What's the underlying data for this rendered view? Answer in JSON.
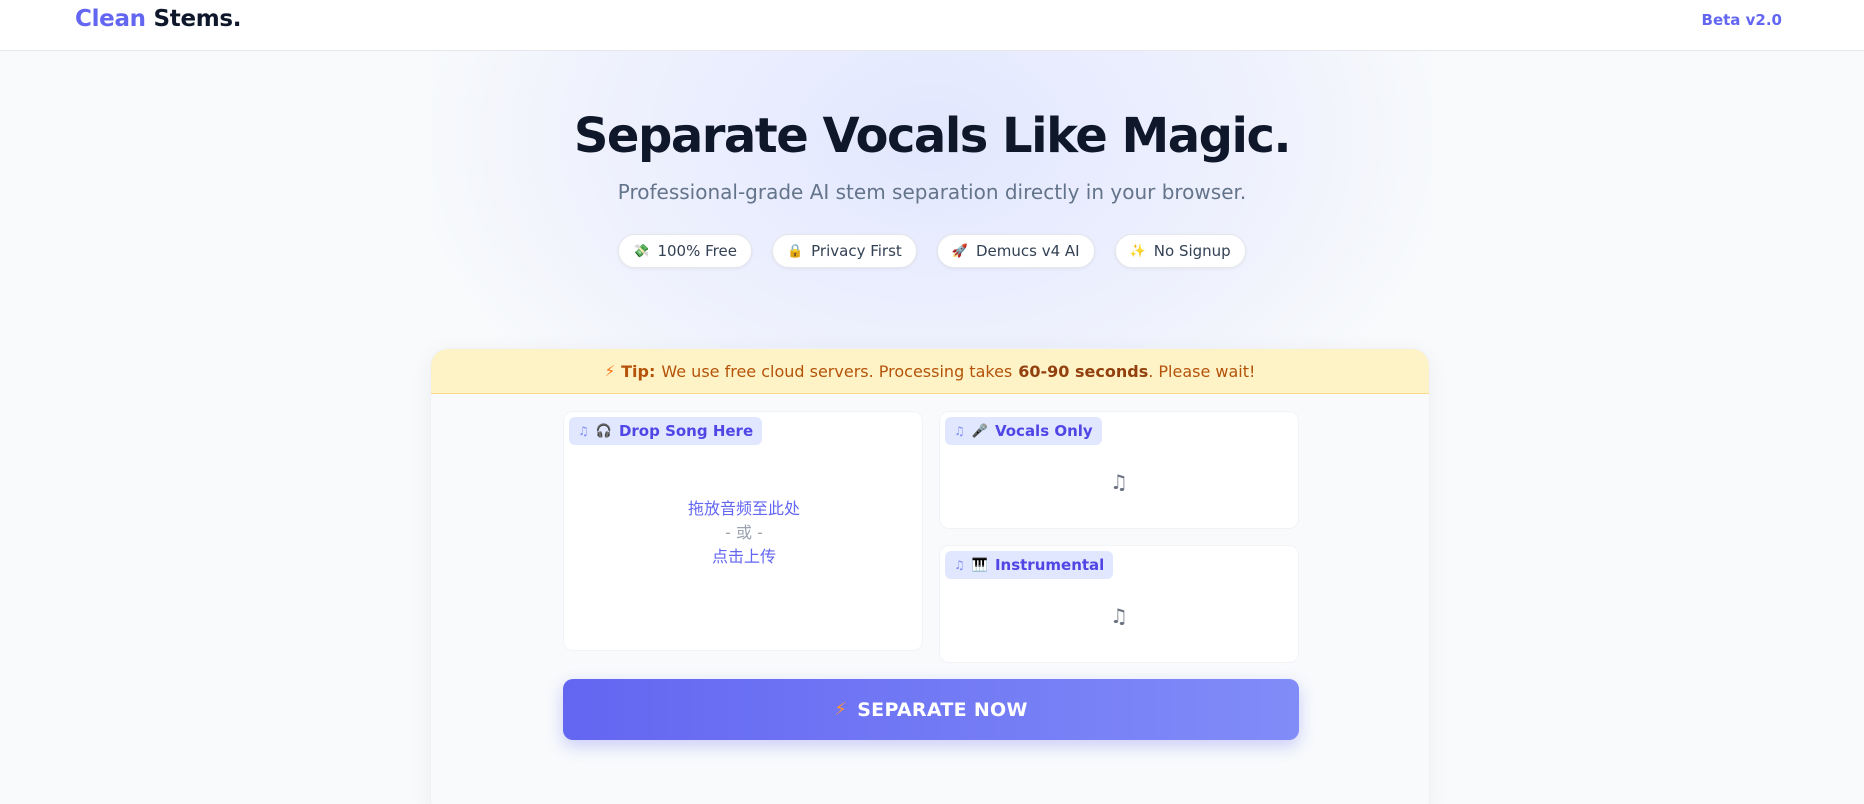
{
  "header": {
    "logo_part1": "Clean",
    "logo_part2": "Stems.",
    "version": "Beta v2.0"
  },
  "hero": {
    "title": "Separate Vocals Like Magic.",
    "subtitle": "Professional-grade AI stem separation directly in your browser."
  },
  "badges": [
    {
      "icon": "💸",
      "label": "100% Free"
    },
    {
      "icon": "🔒",
      "label": "Privacy First"
    },
    {
      "icon": "🚀",
      "label": "Demucs v4 AI"
    },
    {
      "icon": "✨",
      "label": "No Signup"
    }
  ],
  "tip": {
    "icon": "⚡",
    "prefix": "Tip:",
    "text": "We use free cloud servers. Processing takes",
    "highlight": "60-90 seconds",
    "suffix": ". Please wait!"
  },
  "upload_panel": {
    "note_icon": "♫",
    "icon": "🎧",
    "label": "Drop Song Here",
    "drop_line1": "拖放音频至此处",
    "drop_line2": "- 或 -",
    "drop_line3": "点击上传"
  },
  "vocals_panel": {
    "note_icon": "♫",
    "icon": "🎤",
    "label": "Vocals Only",
    "placeholder_icon": "♫"
  },
  "instrumental_panel": {
    "note_icon": "♫",
    "icon": "🎹",
    "label": "Instrumental",
    "placeholder_icon": "♫"
  },
  "action": {
    "icon": "⚡",
    "label": "SEPARATE NOW"
  },
  "colors": {
    "accent": "#6366f1",
    "accent_light": "#818cf8",
    "tip_bg": "#fef3c7",
    "tip_text": "#b45309"
  }
}
